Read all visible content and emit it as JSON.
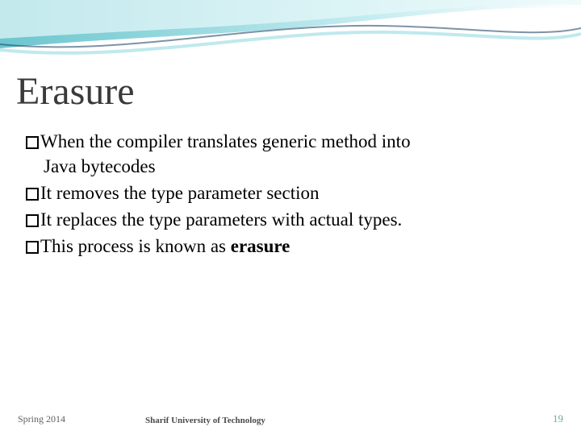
{
  "slide": {
    "title": "Erasure",
    "bullets": [
      {
        "text": "When the compiler translates generic method into",
        "cont": "Java bytecodes"
      },
      {
        "text": "It removes the type parameter section"
      },
      {
        "text": "It replaces the type parameters with actual types."
      },
      {
        "text_pre": "This process is known as ",
        "bold": "erasure"
      }
    ]
  },
  "footer": {
    "left": "Spring 2014",
    "center": "Sharif University of Technology",
    "right": "19"
  }
}
